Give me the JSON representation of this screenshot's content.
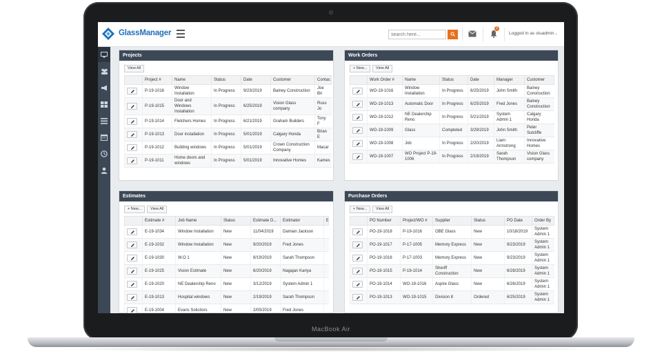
{
  "device": {
    "model": "MacBook Air"
  },
  "brand": {
    "name_part1": "Glass",
    "name_part2": "Manager",
    "accent": "#e8701e",
    "nav_dark": "#3d4857",
    "logo_blue": "#1e6fb8"
  },
  "header": {
    "search_placeholder": "search here...",
    "notification_count": "2",
    "logged_in": "Logged in as stuadmin",
    "icons": [
      "hamburger-icon",
      "search-icon",
      "mail-icon",
      "bell-icon",
      "chevron-down-icon"
    ]
  },
  "sidebar": {
    "items": [
      "monitor-icon",
      "users-icon",
      "megaphone-icon",
      "grid-icon",
      "list-icon",
      "calendar-icon",
      "clock-icon",
      "user-icon"
    ]
  },
  "projects": {
    "title": "Projects",
    "view_all": "View All",
    "columns": [
      "",
      "Project #",
      "Name",
      "Status",
      "Date",
      "Customer",
      "Contac"
    ],
    "rows": [
      [
        "P-19-1016",
        "Window Installation",
        "In Progress",
        "9/23/2019",
        "Bainey Construction",
        "Joe Bri"
      ],
      [
        "P-19-1015",
        "Door and Windows Installation",
        "In Progress",
        "6/25/2019",
        "Vision Glass company",
        "Russ Jo"
      ],
      [
        "P-19-1014",
        "Fletchers Homes",
        "In Progress",
        "6/21/2019",
        "Graham Builders",
        "Tony F"
      ],
      [
        "P-19-1013",
        "Door installation",
        "In Progress",
        "5/01/2019",
        "Calgary Honda",
        "Brian E"
      ],
      [
        "P-19-1012",
        "Building windows",
        "In Progress",
        "5/01/2019",
        "Crown Construction Company",
        "Macar"
      ],
      [
        "P-19-1011",
        "Home doors and windows",
        "In Progress",
        "5/01/2019",
        "Innovative Homes",
        "Kames"
      ]
    ]
  },
  "work_orders": {
    "title": "Work Orders",
    "new": "+ New...",
    "view_all": "View All",
    "columns": [
      "",
      "Work Order #",
      "Name",
      "Status",
      "Date",
      "Manager",
      "Customer"
    ],
    "rows": [
      [
        "WO-19-1016",
        "Window Installation",
        "In Progress",
        "6/25/2019",
        "John Smith",
        "Bainey Construction"
      ],
      [
        "WO-19-1013",
        "Automatic Door",
        "In Progress",
        "6/25/2019",
        "Fred Jones",
        "Bainey Construction"
      ],
      [
        "WO-19-1012",
        "NE Dealership Reno",
        "In Progress",
        "5/21/2019",
        "System Admin 1",
        "Calgary Honda"
      ],
      [
        "WO-19-1009",
        "Glass",
        "Completed",
        "3/29/2019",
        "John Smith",
        "Peter Sutcliffe"
      ],
      [
        "WO-19-1008",
        "Job",
        "In Progress",
        "2/20/2019",
        "Liam Armstrong",
        "Innovative Homes"
      ],
      [
        "WO-19-1007",
        "WO Project P-19-1006",
        "In Progress",
        "2/19/2019",
        "Sarah Thompson",
        "Vision Glass company"
      ]
    ]
  },
  "estimates": {
    "title": "Estimates",
    "new": "+ New...",
    "view_all": "View All",
    "columns": [
      "",
      "Estimate #",
      "Job Name",
      "Status",
      "Estimate D...",
      "Estimator",
      "E"
    ],
    "rows": [
      [
        "E-19-1034",
        "Window Installation",
        "New",
        "11/04/2019",
        "Damian Jackson"
      ],
      [
        "E-19-1032",
        "Window Installation",
        "New",
        "9/20/2019",
        "Fred Jones"
      ],
      [
        "E-19-1030",
        "W.O 1",
        "New",
        "8/19/2019",
        "Sarah Thompson"
      ],
      [
        "E-19-1025",
        "Vision Estimate",
        "New",
        "6/20/2019",
        "Nagajan Kariya"
      ],
      [
        "E-19-1020",
        "NE Dealership Reno",
        "New",
        "3/12/2019",
        "System Admin 1"
      ],
      [
        "E-19-1013",
        "Hospital windows",
        "New",
        "2/19/2019",
        "Sarah Thompson"
      ],
      [
        "E-19-1004",
        "Evans Solicitors",
        "New",
        "2/05/2019",
        "Fred Jones"
      ]
    ]
  },
  "purchase_orders": {
    "title": "Purchase Orders",
    "new": "+ New...",
    "view_all": "View All",
    "columns": [
      "",
      "PO Number",
      "Project/WO #",
      "Supplier",
      "Status",
      "PO Date",
      "Order By"
    ],
    "rows": [
      [
        "PO-19-1018",
        "P-19-1016",
        "OBE Glass",
        "New",
        "10/18/2019",
        "System Admin 1"
      ],
      [
        "PO-19-1017",
        "P-17-1005",
        "Memory Express",
        "New",
        "9/23/2019",
        "System Admin 1"
      ],
      [
        "PO-19-1016",
        "P-17-1003",
        "Memory Express",
        "New",
        "9/23/2019",
        "System Admin 1"
      ],
      [
        "PO-19-1015",
        "P-19-1014",
        "Sheriff Construction",
        "New",
        "6/28/2019",
        "System Admin 1"
      ],
      [
        "PO-19-1014",
        "WO-19-1016",
        "Aspire Glass",
        "New",
        "6/26/2019",
        "System Admin 1"
      ],
      [
        "PO-19-1013",
        "WO-19-1015",
        "Division 8",
        "Ordered",
        "6/25/2019",
        "System Admin 1"
      ]
    ]
  }
}
